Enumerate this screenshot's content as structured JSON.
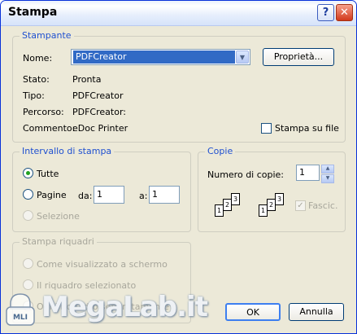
{
  "window": {
    "title": "Stampa"
  },
  "titlebar": {
    "help": "?",
    "close": "✕"
  },
  "printer": {
    "group_title": "Stampante",
    "name_label": "Nome:",
    "name_value": "PDFCreator",
    "properties_button": "Proprietà...",
    "status_label": "Stato:",
    "status_value": "Pronta",
    "type_label": "Tipo:",
    "type_value": "PDFCreator",
    "path_label": "Percorso:",
    "path_value": "PDFCreator:",
    "comment_label": "Commento:",
    "comment_value": "eDoc Printer",
    "print_to_file": "Stampa su file"
  },
  "range": {
    "group_title": "Intervallo di stampa",
    "all": "Tutte",
    "pages": "Pagine",
    "from_label": "da:",
    "from_value": "1",
    "to_label": "a:",
    "to_value": "1",
    "selection": "Selezione"
  },
  "copies": {
    "group_title": "Copie",
    "count_label": "Numero di copie:",
    "count_value": "1",
    "collate": "Fascic.",
    "page_numbers": [
      "1",
      "2",
      "3"
    ]
  },
  "frames": {
    "group_title": "Stampa riquadri",
    "opt1": "Come visualizzato a schermo",
    "opt2": "Il riquadro selezionato",
    "opt3": "Ogni riquadro separatamente"
  },
  "buttons": {
    "ok": "OK",
    "cancel": "Annulla"
  },
  "watermark": {
    "text": "MegaLab.it",
    "logo_text": "MLI"
  }
}
